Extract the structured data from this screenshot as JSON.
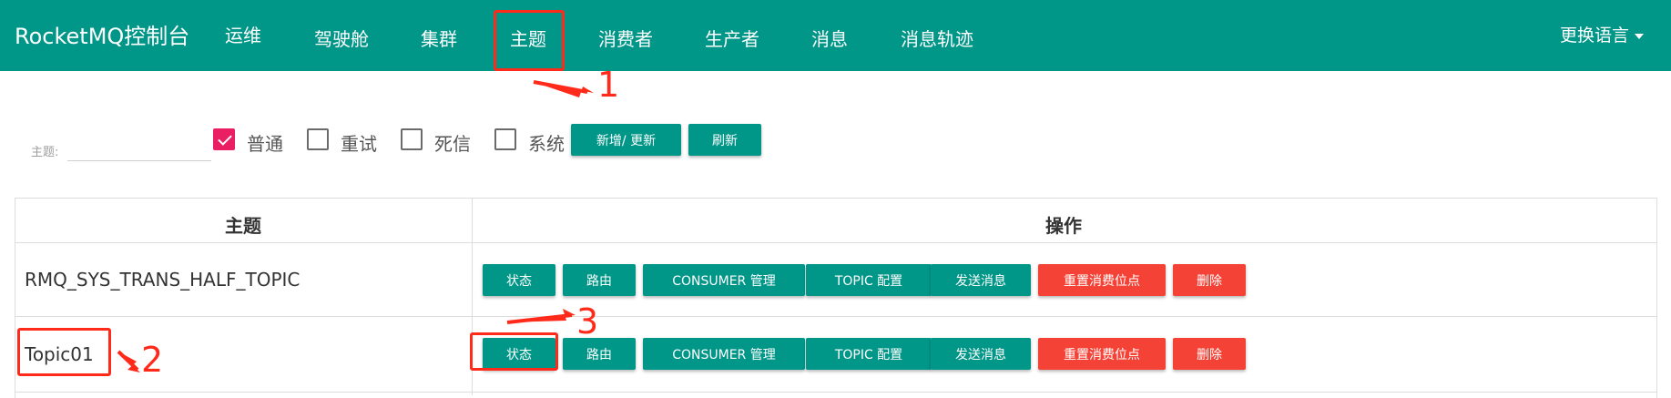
{
  "navbar": {
    "brand": "RocketMQ控制台",
    "items": [
      "运维",
      "驾驶舱",
      "集群",
      "主题",
      "消费者",
      "生产者",
      "消息",
      "消息轨迹"
    ],
    "active_item": "主题",
    "language_label": "更换语言"
  },
  "filter": {
    "topic_label": "主题:",
    "topic_value": "",
    "checkboxes": [
      {
        "label": "普通",
        "checked": true
      },
      {
        "label": "重试",
        "checked": false
      },
      {
        "label": "死信",
        "checked": false
      },
      {
        "label": "系统",
        "checked": false
      }
    ],
    "add_update_button": "新增/ 更新",
    "refresh_button": "刷新"
  },
  "table": {
    "headers": [
      "主题",
      "操作"
    ],
    "actions": [
      "状态",
      "路由",
      "CONSUMER 管理",
      "TOPIC 配置",
      "发送消息",
      "重置消费位点",
      "删除"
    ],
    "rows": [
      {
        "topic": "RMQ_SYS_TRANS_HALF_TOPIC"
      },
      {
        "topic": "Topic01"
      }
    ]
  },
  "annotations": {
    "labels": [
      "1",
      "2",
      "3"
    ],
    "color": "#ff2a1a"
  },
  "colors": {
    "primary": "#009688",
    "danger": "#f44336",
    "checkbox_checked": "#e91e63"
  }
}
